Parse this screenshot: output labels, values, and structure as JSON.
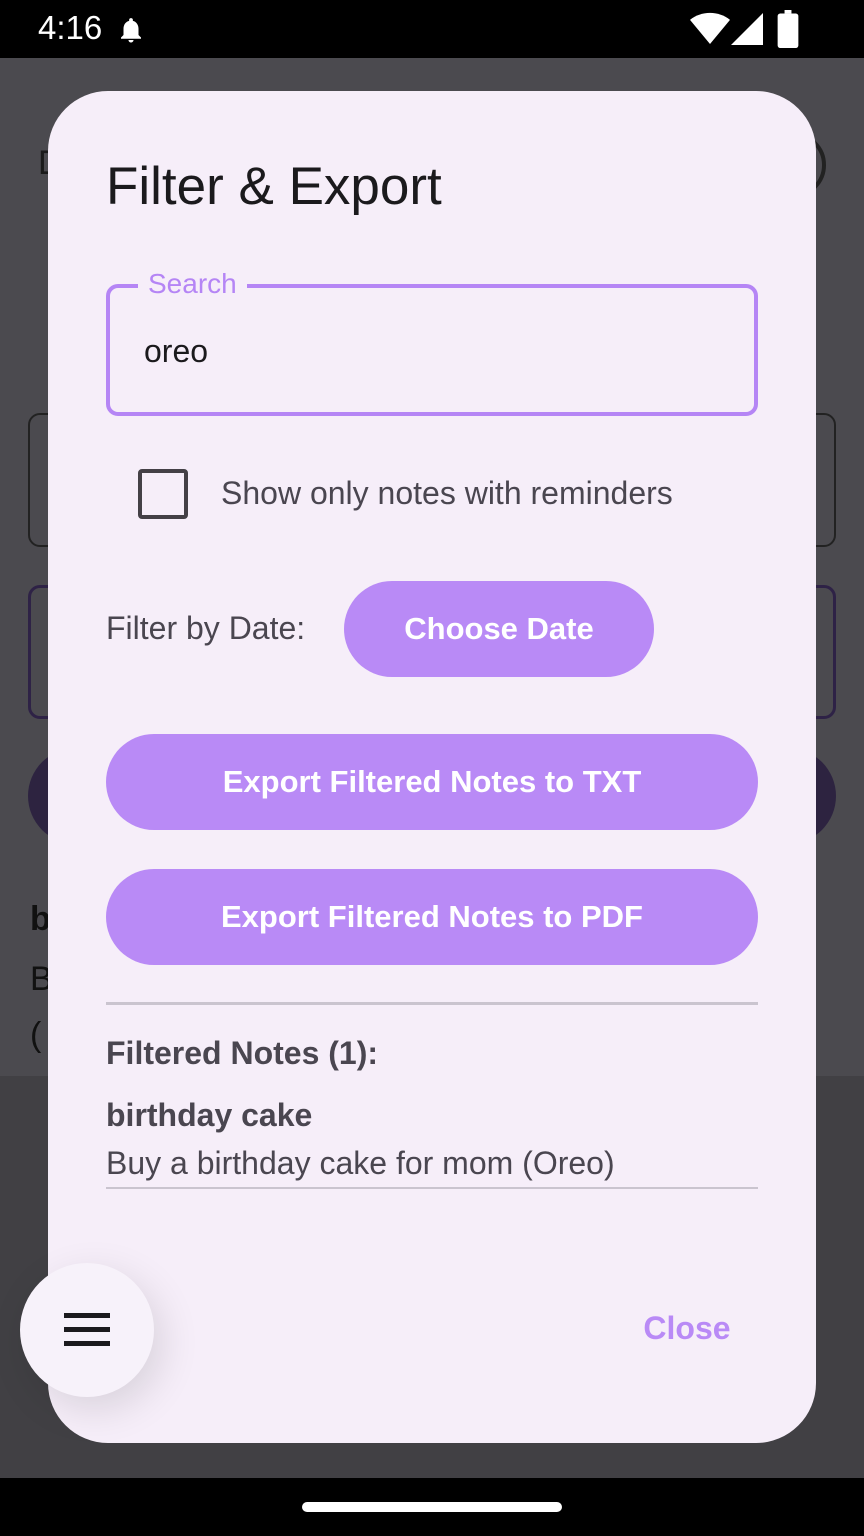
{
  "status_bar": {
    "time": "4:16",
    "icons": [
      "notification-bell-icon",
      "wifi-icon",
      "cellular-signal-icon",
      "battery-icon"
    ]
  },
  "background": {
    "title_fragment": "D",
    "note_title_fragment": "b",
    "note_line1_fragment": "B",
    "note_line2_fragment": "("
  },
  "dialog": {
    "title": "Filter & Export",
    "search": {
      "label": "Search",
      "value": "oreo"
    },
    "reminders_checkbox": {
      "label": "Show only notes with reminders",
      "checked": false
    },
    "date_filter": {
      "label": "Filter by Date:",
      "button_label": "Choose Date"
    },
    "export_txt_label": "Export Filtered Notes to TXT",
    "export_pdf_label": "Export Filtered Notes to PDF",
    "filtered_heading": "Filtered Notes (1):",
    "notes": [
      {
        "title": "birthday cake",
        "body": "Buy a birthday cake for mom (Oreo)"
      }
    ],
    "close_label": "Close"
  },
  "fab": {
    "icon": "menu-icon"
  },
  "colors": {
    "accent": "#b98af6",
    "dialog_bg": "#f6eef9",
    "scrim": "#4b4a4f"
  }
}
